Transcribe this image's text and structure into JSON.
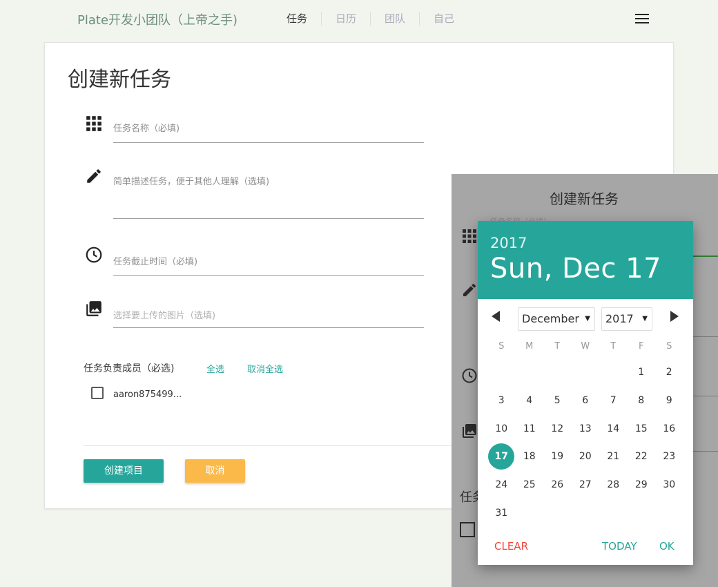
{
  "nav": {
    "brand": "Plate开发小团队（上帝之手)",
    "tabs": [
      {
        "label": "任务",
        "active": true
      },
      {
        "label": "日历",
        "active": false
      },
      {
        "label": "团队",
        "active": false
      },
      {
        "label": "自己",
        "active": false
      }
    ],
    "menu_icon": "hamburger-icon"
  },
  "form": {
    "title": "创建新任务",
    "fields": {
      "name_placeholder": "任务名称（必填)",
      "description_placeholder": "简单描述任务，便于其他人理解（选填)",
      "deadline_placeholder": "任务截止时间（必填)",
      "image_placeholder": "选择要上传的图片（选填)"
    },
    "icons": {
      "name": "grid-icon",
      "description": "pencil-icon",
      "deadline": "clock-icon",
      "image": "photo-library-icon"
    },
    "members": {
      "label": "任务负责成员（必选)",
      "select_all": "全选",
      "deselect_all": "取消全选",
      "list": [
        {
          "name": "aaron875499...",
          "checked": false
        }
      ]
    },
    "buttons": {
      "create": "创建项目",
      "cancel": "取消"
    }
  },
  "overlay": {
    "title": "创建新任务",
    "faint_label": "任务名称（必填)",
    "partial_label": "任务"
  },
  "datepicker": {
    "year": "2017",
    "selected_date_label": "Sun, Dec 17",
    "month_select": "December",
    "year_select": "2017",
    "weekdays": [
      "S",
      "M",
      "T",
      "W",
      "T",
      "F",
      "S"
    ],
    "weeks": [
      [
        "",
        "",
        "",
        "",
        "",
        "1",
        "2"
      ],
      [
        "3",
        "4",
        "5",
        "6",
        "7",
        "8",
        "9"
      ],
      [
        "10",
        "11",
        "12",
        "13",
        "14",
        "15",
        "16"
      ],
      [
        "17",
        "18",
        "19",
        "20",
        "21",
        "22",
        "23"
      ],
      [
        "24",
        "25",
        "26",
        "27",
        "28",
        "29",
        "30"
      ],
      [
        "31",
        "",
        "",
        "",
        "",
        "",
        ""
      ]
    ],
    "selected_day": "17",
    "buttons": {
      "clear": "CLEAR",
      "today": "TODAY",
      "ok": "OK"
    }
  },
  "colors": {
    "accent": "#26a69a",
    "cancel": "#fbb94a",
    "clear": "#f44336",
    "background": "#f2f5ee"
  }
}
